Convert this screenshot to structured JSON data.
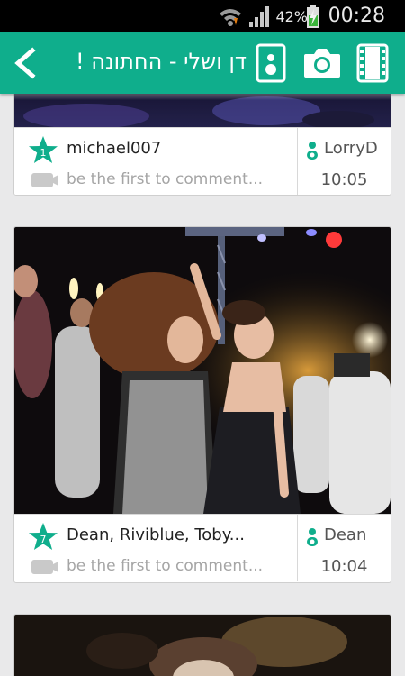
{
  "status_bar": {
    "battery_percent": "42%",
    "clock": "00:28"
  },
  "toolbar": {
    "album_title": "דן ושלי - החתונה !"
  },
  "posts": [
    {
      "liker_count": "1",
      "likers": "michael007",
      "comment_placeholder": "be the first to comment...",
      "uploader": "LorryD",
      "time": "10:05"
    },
    {
      "liker_count": "7",
      "likers": "Dean, Riviblue, Toby...",
      "comment_placeholder": "be the first to comment...",
      "uploader": "Dean",
      "time": "10:04"
    }
  ],
  "colors": {
    "accent": "#0fae8c",
    "card_background": "#ffffff",
    "feed_background": "#e9e9ea"
  }
}
